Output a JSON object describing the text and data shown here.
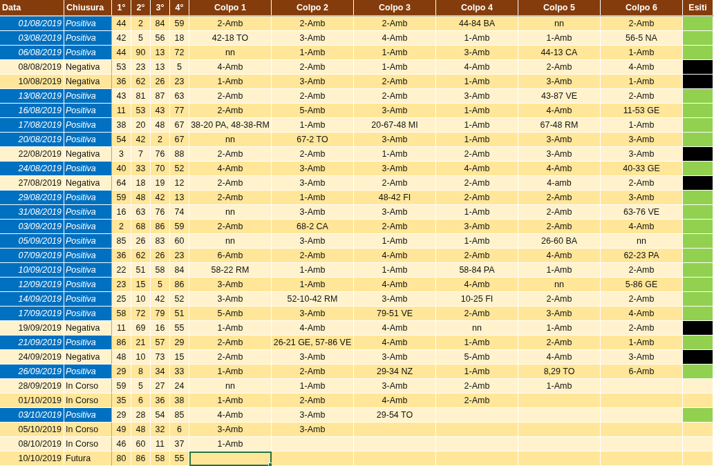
{
  "columns": [
    "Data",
    "Chiusura",
    "1°",
    "2°",
    "3°",
    "4°",
    "Colpo 1",
    "Colpo 2",
    "Colpo 3",
    "Colpo 4",
    "Colpo 5",
    "Colpo 6",
    "Esiti"
  ],
  "rows": [
    {
      "data": "01/08/2019",
      "chiusura": "Positiva",
      "highlighted": true,
      "numeri": [
        "44",
        "2",
        "84",
        "59"
      ],
      "colpi": [
        "2-Amb",
        "2-Amb",
        "2-Amb",
        "44-84 BA",
        "nn",
        "2-Amb"
      ],
      "color": "#92d050",
      "selected": false
    },
    {
      "data": "03/08/2019",
      "chiusura": "Positiva",
      "highlighted": true,
      "numeri": [
        "42",
        "5",
        "56",
        "18"
      ],
      "colpi": [
        "42-18 TO",
        "3-Amb",
        "4-Amb",
        "1-Amb",
        "1-Amb",
        "56-5 NA"
      ],
      "color": "#92d050",
      "selected": false
    },
    {
      "data": "06/08/2019",
      "chiusura": "Positiva",
      "highlighted": true,
      "numeri": [
        "44",
        "90",
        "13",
        "72"
      ],
      "colpi": [
        "nn",
        "1-Amb",
        "1-Amb",
        "3-Amb",
        "44-13 CA",
        "1-Amb"
      ],
      "color": "#92d050",
      "selected": false
    },
    {
      "data": "08/08/2019",
      "chiusura": "Negativa",
      "highlighted": false,
      "numeri": [
        "53",
        "23",
        "13",
        "5"
      ],
      "colpi": [
        "4-Amb",
        "2-Amb",
        "1-Amb",
        "4-Amb",
        "2-Amb",
        "4-Amb"
      ],
      "color": "#000000",
      "selected": false
    },
    {
      "data": "10/08/2019",
      "chiusura": "Negativa",
      "highlighted": false,
      "numeri": [
        "36",
        "62",
        "26",
        "23"
      ],
      "colpi": [
        "1-Amb",
        "3-Amb",
        "2-Amb",
        "1-Amb",
        "3-Amb",
        "1-Amb"
      ],
      "color": "#000000",
      "selected": false
    },
    {
      "data": "13/08/2019",
      "chiusura": "Positiva",
      "highlighted": true,
      "numeri": [
        "43",
        "81",
        "87",
        "63"
      ],
      "colpi": [
        "2-Amb",
        "2-Amb",
        "2-Amb",
        "3-Amb",
        "43-87 VE",
        "2-Amb"
      ],
      "color": "#92d050",
      "selected": false
    },
    {
      "data": "16/08/2019",
      "chiusura": "Positiva",
      "highlighted": true,
      "numeri": [
        "11",
        "53",
        "43",
        "77"
      ],
      "colpi": [
        "2-Amb",
        "5-Amb",
        "3-Amb",
        "1-Amb",
        "4-Amb",
        "11-53 GE"
      ],
      "color": "#92d050",
      "selected": false
    },
    {
      "data": "17/08/2019",
      "chiusura": "Positiva",
      "highlighted": true,
      "numeri": [
        "38",
        "20",
        "48",
        "67"
      ],
      "colpi": [
        "38-20 PA, 48-38-RM",
        "1-Amb",
        "20-67-48 MI",
        "1-Amb",
        "67-48 RM",
        "1-Amb"
      ],
      "color": "#92d050",
      "selected": false
    },
    {
      "data": "20/08/2019",
      "chiusura": "Positiva",
      "highlighted": true,
      "numeri": [
        "54",
        "42",
        "2",
        "67"
      ],
      "colpi": [
        "nn",
        "67-2 TO",
        "3-Amb",
        "1-Amb",
        "3-Amb",
        "3-Amb"
      ],
      "color": "#92d050",
      "selected": false
    },
    {
      "data": "22/08/2019",
      "chiusura": "Negativa",
      "highlighted": false,
      "numeri": [
        "3",
        "7",
        "76",
        "88"
      ],
      "colpi": [
        "2-Amb",
        "2-Amb",
        "1-Amb",
        "2-Amb",
        "3-Amb",
        "3-Amb"
      ],
      "color": "#000000",
      "selected": false
    },
    {
      "data": "24/08/2019",
      "chiusura": "Positiva",
      "highlighted": true,
      "numeri": [
        "40",
        "33",
        "70",
        "52"
      ],
      "colpi": [
        "4-Amb",
        "3-Amb",
        "3-Amb",
        "4-Amb",
        "4-Amb",
        "40-33 GE"
      ],
      "color": "#92d050",
      "selected": false
    },
    {
      "data": "27/08/2019",
      "chiusura": "Negativa",
      "highlighted": false,
      "numeri": [
        "64",
        "18",
        "19",
        "12"
      ],
      "colpi": [
        "2-Amb",
        "3-Amb",
        "2-Amb",
        "2-Amb",
        "4-amb",
        "2-Amb"
      ],
      "color": "#000000",
      "selected": false
    },
    {
      "data": "29/08/2019",
      "chiusura": "Positiva",
      "highlighted": true,
      "numeri": [
        "59",
        "48",
        "42",
        "13"
      ],
      "colpi": [
        "2-Amb",
        "1-Amb",
        "48-42 FI",
        "2-Amb",
        "2-Amb",
        "3-Amb"
      ],
      "color": "#92d050",
      "selected": false
    },
    {
      "data": "31/08/2019",
      "chiusura": "Positiva",
      "highlighted": true,
      "numeri": [
        "16",
        "63",
        "76",
        "74"
      ],
      "colpi": [
        "nn",
        "3-Amb",
        "3-Amb",
        "1-Amb",
        "2-Amb",
        "63-76 VE"
      ],
      "color": "#92d050",
      "selected": false
    },
    {
      "data": "03/09/2019",
      "chiusura": "Positiva",
      "highlighted": true,
      "numeri": [
        "2",
        "68",
        "86",
        "59"
      ],
      "colpi": [
        "2-Amb",
        "68-2 CA",
        "2-Amb",
        "3-Amb",
        "2-Amb",
        "4-Amb"
      ],
      "color": "#92d050",
      "selected": false
    },
    {
      "data": "05/09/2019",
      "chiusura": "Positiva",
      "highlighted": true,
      "numeri": [
        "85",
        "26",
        "83",
        "60"
      ],
      "colpi": [
        "nn",
        "3-Amb",
        "1-Amb",
        "1-Amb",
        "26-60 BA",
        "nn"
      ],
      "color": "#92d050",
      "selected": false
    },
    {
      "data": "07/09/2019",
      "chiusura": "Positiva",
      "highlighted": true,
      "numeri": [
        "36",
        "62",
        "26",
        "23"
      ],
      "colpi": [
        "6-Amb",
        "2-Amb",
        "4-Amb",
        "2-Amb",
        "4-Amb",
        "62-23 PA"
      ],
      "color": "#92d050",
      "selected": false
    },
    {
      "data": "10/09/2019",
      "chiusura": "Positiva",
      "highlighted": true,
      "numeri": [
        "22",
        "51",
        "58",
        "84"
      ],
      "colpi": [
        "58-22 RM",
        "1-Amb",
        "1-Amb",
        "58-84 PA",
        "1-Amb",
        "2-Amb"
      ],
      "color": "#92d050",
      "selected": false
    },
    {
      "data": "12/09/2019",
      "chiusura": "Positiva",
      "highlighted": true,
      "numeri": [
        "23",
        "15",
        "5",
        "86"
      ],
      "colpi": [
        "3-Amb",
        "1-Amb",
        "4-Amb",
        "4-Amb",
        "nn",
        "5-86 GE"
      ],
      "color": "#92d050",
      "selected": false
    },
    {
      "data": "14/09/2019",
      "chiusura": "Positiva",
      "highlighted": true,
      "numeri": [
        "25",
        "10",
        "42",
        "52"
      ],
      "colpi": [
        "3-Amb",
        "52-10-42 RM",
        "3-Amb",
        "10-25 FI",
        "2-Amb",
        "2-Amb"
      ],
      "color": "#92d050",
      "selected": false
    },
    {
      "data": "17/09/2019",
      "chiusura": "Positiva",
      "highlighted": true,
      "numeri": [
        "58",
        "72",
        "79",
        "51"
      ],
      "colpi": [
        "5-Amb",
        "3-Amb",
        "79-51 VE",
        "2-Amb",
        "3-Amb",
        "4-Amb"
      ],
      "color": "#92d050",
      "selected": false
    },
    {
      "data": "19/09/2019",
      "chiusura": "Negativa",
      "highlighted": false,
      "numeri": [
        "11",
        "69",
        "16",
        "55"
      ],
      "colpi": [
        "1-Amb",
        "4-Amb",
        "4-Amb",
        "nn",
        "1-Amb",
        "2-Amb"
      ],
      "color": "#000000",
      "selected": false
    },
    {
      "data": "21/09/2019",
      "chiusura": "Positiva",
      "highlighted": true,
      "numeri": [
        "86",
        "21",
        "57",
        "29"
      ],
      "colpi": [
        "2-Amb",
        "26-21 GE, 57-86 VE",
        "4-Amb",
        "1-Amb",
        "2-Amb",
        "1-Amb"
      ],
      "color": "#92d050",
      "selected": false
    },
    {
      "data": "24/09/2019",
      "chiusura": "Negativa",
      "highlighted": false,
      "numeri": [
        "48",
        "10",
        "73",
        "15"
      ],
      "colpi": [
        "2-Amb",
        "3-Amb",
        "3-Amb",
        "5-Amb",
        "4-Amb",
        "3-Amb"
      ],
      "color": "#000000",
      "selected": false
    },
    {
      "data": "26/09/2019",
      "chiusura": "Positiva",
      "highlighted": true,
      "numeri": [
        "29",
        "8",
        "34",
        "33"
      ],
      "colpi": [
        "1-Amb",
        "2-Amb",
        "29-34 NZ",
        "1-Amb",
        "8,29 TO",
        "6-Amb"
      ],
      "color": "#92d050",
      "selected": false
    },
    {
      "data": "28/09/2019",
      "chiusura": "In Corso",
      "highlighted": false,
      "numeri": [
        "59",
        "5",
        "27",
        "24"
      ],
      "colpi": [
        "nn",
        "1-Amb",
        "3-Amb",
        "2-Amb",
        "1-Amb"
      ],
      "selected": false
    },
    {
      "data": "01/10/2019",
      "chiusura": "In Corso",
      "highlighted": false,
      "numeri": [
        "35",
        "6",
        "36",
        "38"
      ],
      "colpi": [
        "1-Amb",
        "2-Amb",
        "4-Amb",
        "2-Amb"
      ],
      "selected": false
    },
    {
      "data": "03/10/2019",
      "chiusura": "Positiva",
      "highlighted": true,
      "numeri": [
        "29",
        "28",
        "54",
        "85"
      ],
      "colpi": [
        "4-Amb",
        "3-Amb",
        "29-54 TO"
      ],
      "color": "#92d050",
      "selected": false
    },
    {
      "data": "05/10/2019",
      "chiusura": "In Corso",
      "highlighted": false,
      "numeri": [
        "49",
        "48",
        "32",
        "6"
      ],
      "colpi": [
        "3-Amb",
        "3-Amb"
      ],
      "selected": false
    },
    {
      "data": "08/10/2019",
      "chiusura": "In Corso",
      "highlighted": false,
      "numeri": [
        "46",
        "60",
        "11",
        "37"
      ],
      "colpi": [
        "1-Amb"
      ],
      "selected": false
    },
    {
      "data": "10/10/2019",
      "chiusura": "Futura",
      "highlighted": false,
      "numeri": [
        "80",
        "86",
        "58",
        "55"
      ],
      "selected": true
    }
  ]
}
